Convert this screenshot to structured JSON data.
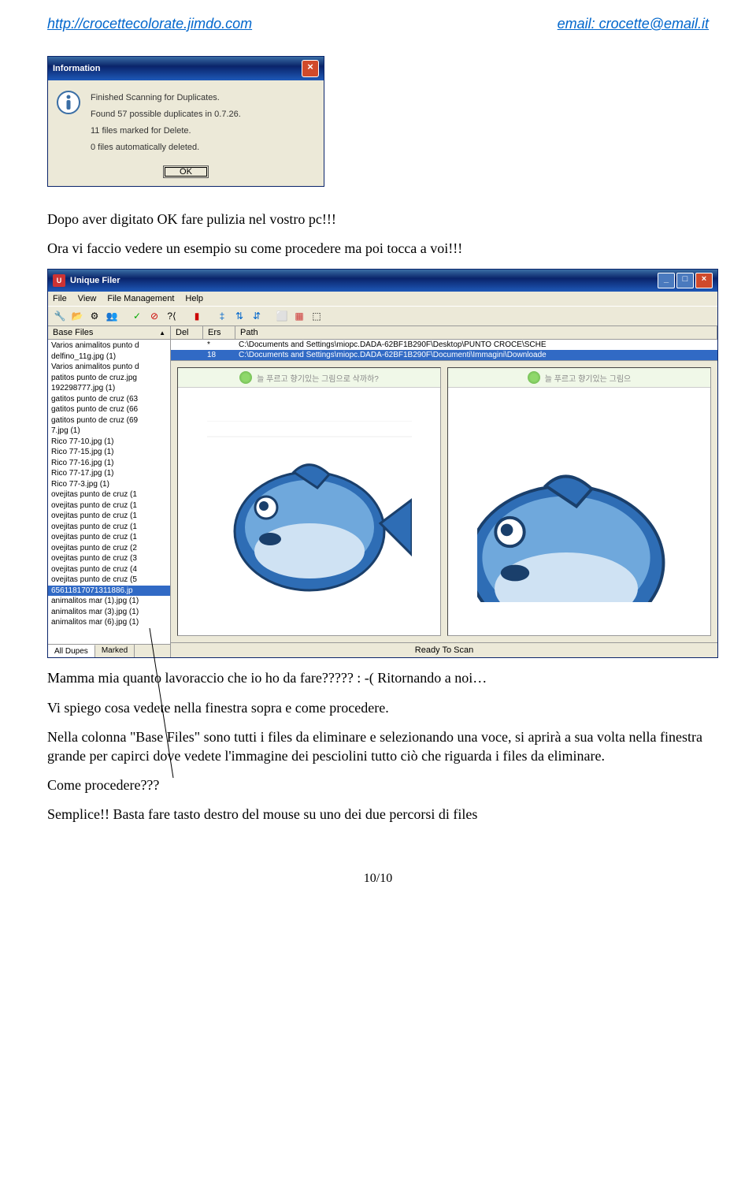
{
  "header": {
    "site_url": "http://crocettecolorate.jimdo.com",
    "email_label": "email: crocette@email.it"
  },
  "info_dialog": {
    "title": "Information",
    "lines": [
      "Finished Scanning for Duplicates.",
      "Found 57 possible duplicates in 0.7.26.",
      "11 files marked for Delete.",
      "0 files automatically deleted."
    ],
    "ok": "OK"
  },
  "para1": "Dopo aver digitato OK fare pulizia nel vostro pc!!!",
  "para2": "Ora vi faccio vedere un esempio su come procedere ma poi tocca a voi!!!",
  "app": {
    "title": "Unique Filer",
    "menu": [
      "File",
      "View",
      "File Management",
      "Help"
    ],
    "base_files_header": "Base Files",
    "path_headers": [
      "Del",
      "Ers",
      "Path"
    ],
    "paths": [
      {
        "del": "",
        "ers": "*",
        "path": "C:\\Documents and Settings\\miopc.DADA-62BF1B290F\\Desktop\\PUNTO CROCE\\SCHE"
      },
      {
        "del": "",
        "ers": "18",
        "path": "C:\\Documents and Settings\\miopc.DADA-62BF1B290F\\Documenti\\Immagini\\Downloade"
      }
    ],
    "files": [
      "Varios animalitos punto d",
      "delfino_11g.jpg (1)",
      "Varios animalitos punto d",
      "patitos punto de cruz.jpg",
      "192298777.jpg (1)",
      "gatitos punto de cruz (63",
      "gatitos punto de cruz (66",
      "gatitos punto de cruz (69",
      "7.jpg (1)",
      "Rico 77-10.jpg (1)",
      "Rico 77-15.jpg (1)",
      "Rico 77-16.jpg (1)",
      "Rico 77-17.jpg (1)",
      "Rico 77-3.jpg (1)",
      "ovejitas punto de cruz (1",
      "ovejitas punto de cruz (1",
      "ovejitas punto de cruz (1",
      "ovejitas punto de cruz (1",
      "ovejitas punto de cruz (1",
      "ovejitas punto de cruz (2",
      "ovejitas punto de cruz (3",
      "ovejitas punto de cruz (4",
      "ovejitas punto de cruz (5",
      "65611817071311886.jp",
      "animalitos mar (1).jpg (1)",
      "animalitos mar (3).jpg (1)",
      "animalitos mar (6).jpg (1)"
    ],
    "selected_file_index": 23,
    "tabs": [
      "All Dupes",
      "Marked"
    ],
    "banner1": "늘 푸르고 향기있는 그림으로 삭까하?",
    "banner2": "늘 푸르고 향기있는 그림으",
    "status": "Ready To Scan"
  },
  "para3": "Mamma mia quanto lavoraccio che io ho da fare????? : -(     Ritornando a noi…",
  "para4": "Vi spiego cosa vedete nella finestra sopra e come procedere.",
  "para5": "Nella colonna \"Base Files\" sono tutti i files da eliminare e selezionando una voce, si aprirà a sua volta nella finestra grande per capirci dove vedete l'immagine dei pesciolini tutto ciò che riguarda i files da eliminare.",
  "para6": "Come procedere???",
  "para7": "Semplice!! Basta fare tasto destro del mouse su uno dei due percorsi di files",
  "page_num": "10/10"
}
